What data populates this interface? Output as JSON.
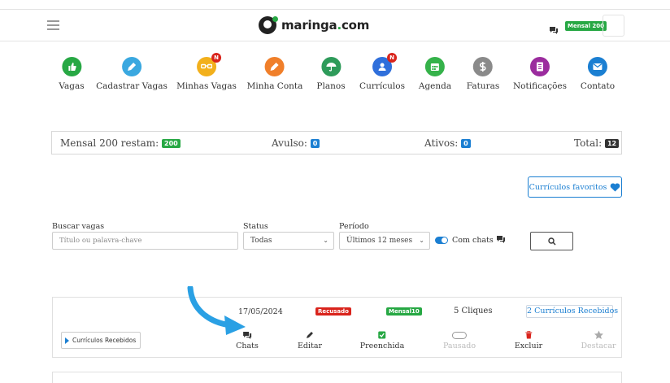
{
  "header": {
    "logo_text": "maringa",
    "logo_dot": ".",
    "logo_tld": "com",
    "plan_badge": "Mensal 200",
    "icons": {
      "menu": "hamburger-icon",
      "chat": "chat-icon"
    }
  },
  "nav": [
    {
      "label": "Vagas",
      "icon": "thumbs-up-icon",
      "color": "#27a844",
      "badge": ""
    },
    {
      "label": "Cadastrar Vagas",
      "icon": "pen-icon",
      "color": "#3aa8e0",
      "badge": ""
    },
    {
      "label": "Minhas Vagas",
      "icon": "glasses-icon",
      "color": "#f2b01c",
      "badge": "N"
    },
    {
      "label": "Minha Conta",
      "icon": "edit-icon",
      "color": "#f07f2a",
      "badge": ""
    },
    {
      "label": "Planos",
      "icon": "umbrella-icon",
      "color": "#2e9b5a",
      "badge": ""
    },
    {
      "label": "Currículos",
      "icon": "users-icon",
      "color": "#2f6fdb",
      "badge": "N"
    },
    {
      "label": "Agenda",
      "icon": "calendar-icon",
      "color": "#35b24a",
      "badge": ""
    },
    {
      "label": "Faturas",
      "icon": "dollar-icon",
      "color": "#8a8a8a",
      "badge": ""
    },
    {
      "label": "Notificações",
      "icon": "document-icon",
      "color": "#9b2c9e",
      "badge": ""
    },
    {
      "label": "Contato",
      "icon": "envelope-icon",
      "color": "#1b7fd2",
      "badge": ""
    }
  ],
  "stats": {
    "mensal_label": "Mensal 200 restam:",
    "mensal_value": "200",
    "avulso_label": "Avulso:",
    "avulso_value": "0",
    "ativos_label": "Ativos:",
    "ativos_value": "0",
    "total_label": "Total:",
    "total_value": "12"
  },
  "favoritos_button": "Currículos favoritos",
  "filters": {
    "search_label": "Buscar vagas",
    "search_placeholder": "Título ou palavra-chave",
    "status_label": "Status",
    "status_value": "Todas",
    "periodo_label": "Período",
    "periodo_value": "Últimos 12 meses",
    "com_chats_label": "Com chats",
    "com_chats_enabled": true
  },
  "job_card": {
    "date": "17/05/2024",
    "status_tag": "Recusado",
    "plan_tag": "Mensal10",
    "clicks": "5 Cliques",
    "received_link": "2 Currículos Recebidos",
    "left_button": "Currículos Recebidos",
    "actions": [
      {
        "label": "Chats",
        "icon": "chat-icon",
        "enabled": true
      },
      {
        "label": "Editar",
        "icon": "pencil-icon",
        "enabled": true
      },
      {
        "label": "Preenchida",
        "icon": "checkbox-icon",
        "enabled": true
      },
      {
        "label": "Pausado",
        "icon": "toggle-icon",
        "enabled": false
      },
      {
        "label": "Excluir",
        "icon": "trash-icon",
        "enabled": true
      },
      {
        "label": "Destacar",
        "icon": "star-icon",
        "enabled": false
      }
    ]
  },
  "colors": {
    "green": "#27a844",
    "blue": "#1b7fd2",
    "red": "#d9241c",
    "arrow": "#2aa0e4"
  }
}
